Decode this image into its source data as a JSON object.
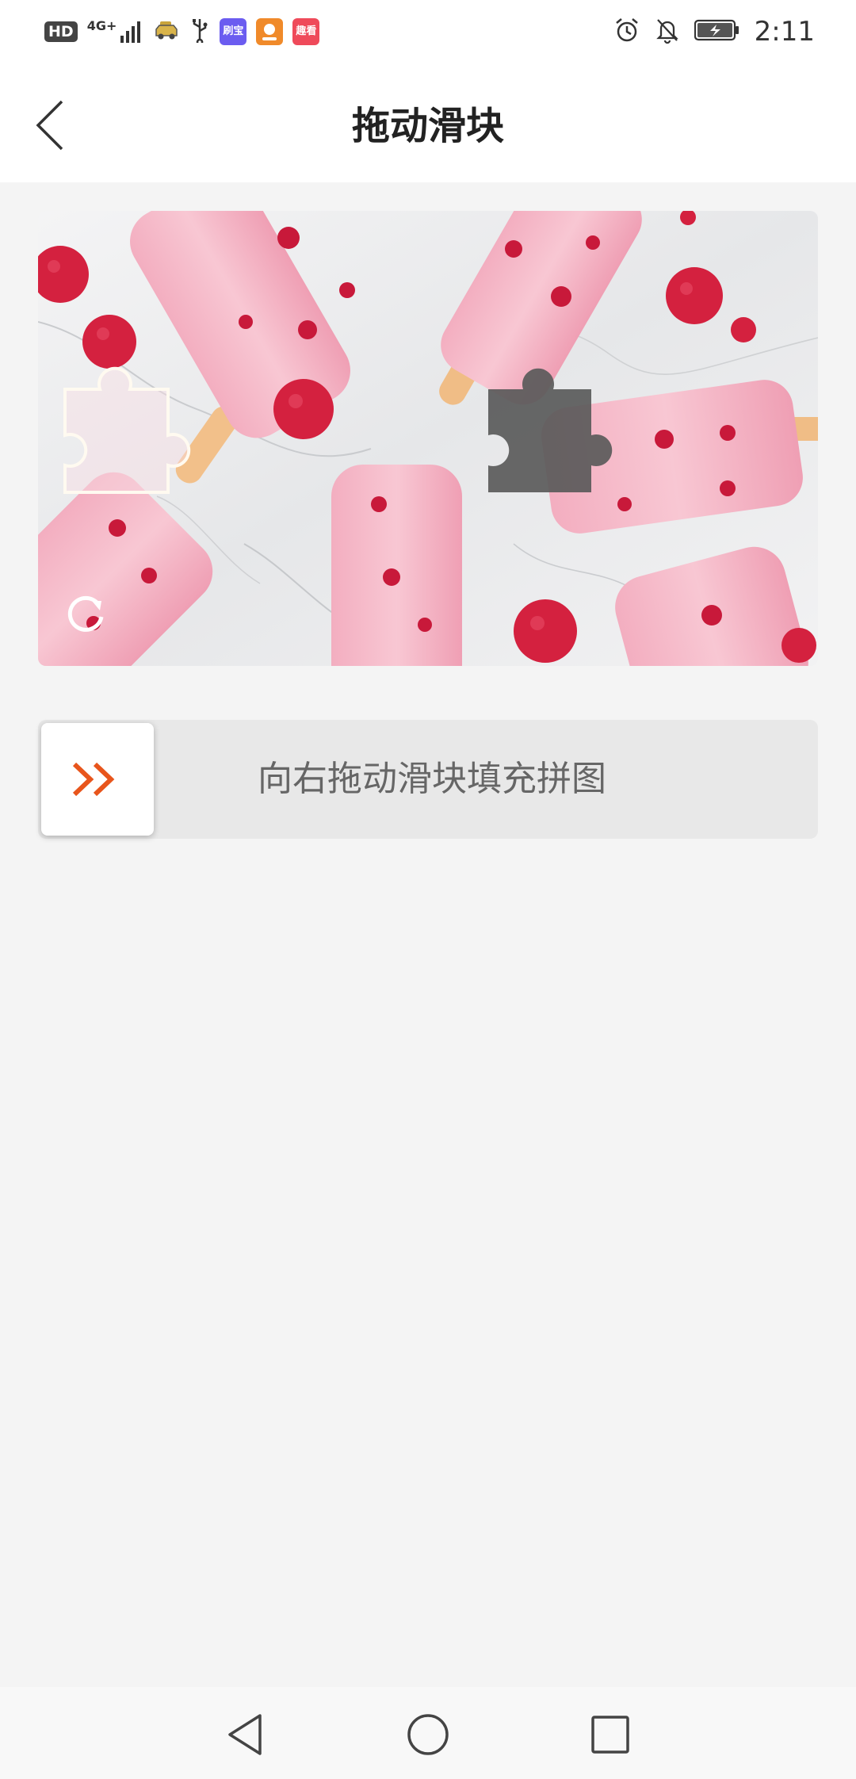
{
  "status_bar": {
    "hd_label": "HD",
    "network_label": "4G+",
    "app_icons": [
      {
        "name": "刷宝",
        "color": "#6b5cf0"
      },
      {
        "name": "",
        "color": "#f08a2a"
      },
      {
        "name": "趣看",
        "color": "#ef4a5a"
      }
    ],
    "time": "2:11"
  },
  "header": {
    "title": "拖动滑块"
  },
  "captcha": {
    "refresh_icon": "refresh-icon",
    "hole_color": "#555555"
  },
  "slider": {
    "hint": "向右拖动滑块填充拼图",
    "arrow_icon": "double-chevron-right-icon",
    "accent": "#e8551c",
    "progress": 0
  },
  "nav": {
    "back_icon": "triangle-back-icon",
    "home_icon": "circle-home-icon",
    "recents_icon": "square-recents-icon"
  }
}
